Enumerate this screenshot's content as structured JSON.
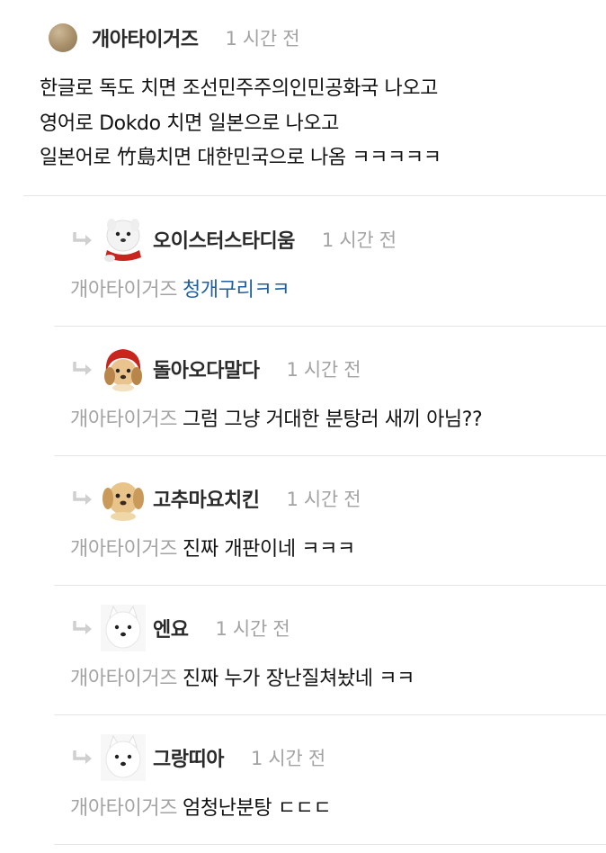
{
  "post": {
    "author": "개아타이거즈",
    "time": "1 시간 전",
    "lines": [
      "한글로 독도 치면 조선민주주의인민공화국 나오고",
      "영어로 Dokdo 치면 일본으로 나오고",
      "일본어로 竹島치면 대한민국으로 나옴 ㅋㅋㅋㅋㅋ"
    ]
  },
  "replies": [
    {
      "author": "오이스터스타디움",
      "time": "1 시간 전",
      "mention": "개아타이거즈",
      "text": "청개구리ㅋㅋ",
      "text_color": "#1f5f9e",
      "avatar": "white-dog-red-scarf-avatar"
    },
    {
      "author": "돌아오다말다",
      "time": "1 시간 전",
      "mention": "개아타이거즈",
      "text": "그럼 그냥 거대한 분탕러 새끼 아님??",
      "text_color": "#111111",
      "avatar": "puppy-red-hood-avatar"
    },
    {
      "author": "고추마요치킨",
      "time": "1 시간 전",
      "mention": "개아타이거즈",
      "text": "진짜 개판이네 ㅋㅋㅋ",
      "text_color": "#111111",
      "avatar": "golden-puppy-avatar"
    },
    {
      "author": "엔요",
      "time": "1 시간 전",
      "mention": "개아타이거즈",
      "text": "진짜 누가 장난질쳐놨네 ㅋㅋ",
      "text_color": "#111111",
      "avatar": "white-samoyed-avatar"
    },
    {
      "author": "그랑띠아",
      "time": "1 시간 전",
      "mention": "개아타이거즈",
      "text": "엄청난분탕 ㄷㄷㄷ",
      "text_color": "#111111",
      "avatar": "white-samoyed-avatar"
    }
  ]
}
